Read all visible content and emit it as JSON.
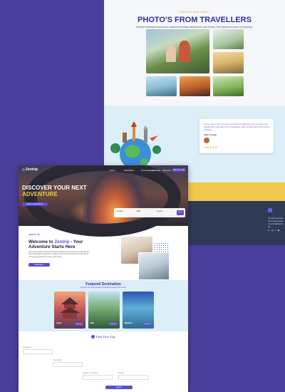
{
  "gallery": {
    "eyebrow": "Photo Gallery",
    "title": "PHOTO'S FROM TRAVELLERS",
    "subtitle": "Browse inspiring travel photos captured by fellow adventurers and Zentrip. Get inspired for your next journey."
  },
  "testimonial": {
    "quote": "Lorem ipsum dolor sit amet consectetur adipiscing elit sed diam nisi repellendus eget laborum consequatur quae reprehenderit illum proin pharetra.",
    "name": "John Cooper",
    "rating": 5,
    "stars": "★★★★★"
  },
  "footer": {
    "text": "All rights reserved. Lorem ipsum dolor sit amet adipiscing elit.",
    "social": "X ◎ f ▶"
  },
  "zentrip": {
    "brand": "Zentrip",
    "nav": [
      "Home",
      "Destination",
      "Tour Packages",
      "Booking",
      "About Us"
    ],
    "nav_button": "Sign up / Login",
    "hero": {
      "heading_1": "DISCOVER YOUR NEXT",
      "heading_2": "ADVENTURE",
      "button": "Explore Destinations"
    },
    "search": {
      "fields": [
        "Location",
        "Date",
        "Guests"
      ],
      "button": "Search"
    },
    "about": {
      "eyebrow": "ABOUT US",
      "heading_1": "Welcome to",
      "heading_accent": "Zentrip",
      "heading_2": "- Your Adventure Starts Here",
      "body": "Lorem ipsum dolor sit amet consectetur adipiscing elit. Zentrip connects travelers with unforgettable destinations, curated experiences and trusted local guides so every journey becomes a story worth telling.",
      "button": "Read More"
    },
    "featured": {
      "title": "Featured Destination",
      "subtitle": "Explore the most popular destinations around the world",
      "cards": [
        {
          "label": "Japan",
          "button": "Book Now"
        },
        {
          "label": "Bali",
          "button": "Book Now"
        },
        {
          "label": "Maldives",
          "button": "Book Now"
        }
      ]
    },
    "plan": {
      "title": "Plan Your Trip",
      "fields": [
        "Destination",
        "Travel Date",
        "Number of Travelers",
        "Budget"
      ],
      "button": "Submit"
    }
  },
  "colors": {
    "brand_purple": "#4b3f9e",
    "accent_purple": "#5a4fcf",
    "accent_yellow": "#f2c94c",
    "light_blue": "#dceef8"
  }
}
